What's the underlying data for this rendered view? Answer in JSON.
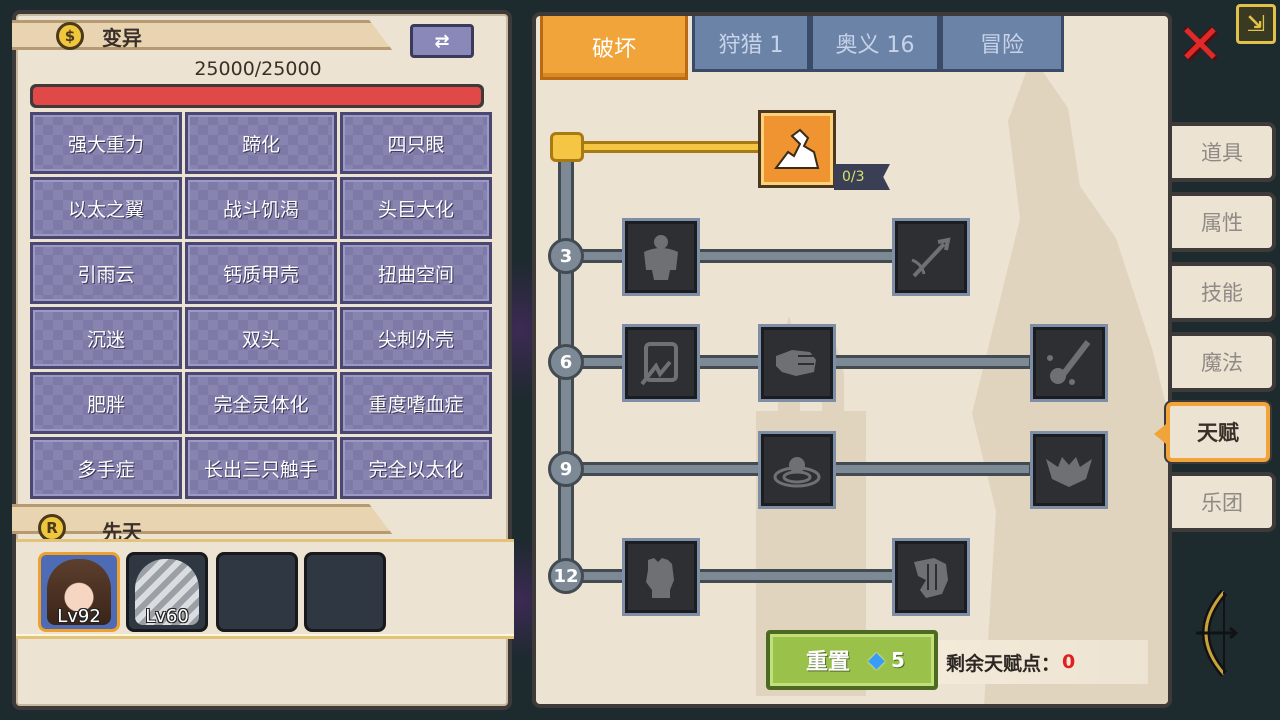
{
  "left_panel": {
    "banner_icon": "$",
    "banner_title": "变异",
    "swap_button_label": "⇄",
    "hp_text": "25000/25000",
    "hp_fraction": 1.0,
    "mutations": [
      "强大重力",
      "蹄化",
      "四只眼",
      "以太之翼",
      "战斗饥渴",
      "头巨大化",
      "引雨云",
      "钙质甲壳",
      "扭曲空间",
      "沉迷",
      "双头",
      "尖刺外壳",
      "肥胖",
      "完全灵体化",
      "重度嗜血症",
      "多手症",
      "长出三只触手",
      "完全以太化"
    ],
    "innate_icon": "R",
    "innate_title": "先天",
    "slots": [
      {
        "label": "Lv92",
        "icon": "princess-portrait-icon"
      },
      {
        "label": "Lv60",
        "icon": "ghost-portrait-icon"
      },
      {
        "label": "",
        "icon": "empty-slot"
      },
      {
        "label": "",
        "icon": "empty-slot"
      }
    ]
  },
  "talent_panel": {
    "tabs": [
      {
        "label": "破坏",
        "active": true
      },
      {
        "label": "狩猎 1",
        "active": false
      },
      {
        "label": "奥义 16",
        "active": false
      },
      {
        "label": "冒险",
        "active": false
      }
    ],
    "root_node": {
      "icon": "arm-wrestle-icon",
      "count": "0/3"
    },
    "levels": [
      "3",
      "6",
      "9",
      "12"
    ],
    "nodes": [
      {
        "tier": "3",
        "icon": "giant-body-icon"
      },
      {
        "tier": "3",
        "icon": "arrow-hit-icon"
      },
      {
        "tier": "6",
        "icon": "shield-break-icon"
      },
      {
        "tier": "6",
        "icon": "punch-icon"
      },
      {
        "tier": "6",
        "icon": "slash-splatter-icon"
      },
      {
        "tier": "9",
        "icon": "shockwave-icon"
      },
      {
        "tier": "9",
        "icon": "demon-bat-icon"
      },
      {
        "tier": "12",
        "icon": "fist-icon"
      },
      {
        "tier": "12",
        "icon": "fist-side-icon"
      }
    ],
    "reset_button": {
      "label": "重置",
      "gem_icon": "diamond-icon",
      "cost": "5"
    },
    "remaining_label": "剩余天赋点：",
    "remaining_value": "0"
  },
  "side_tabs": [
    {
      "label": "道具",
      "active": false
    },
    {
      "label": "属性",
      "active": false
    },
    {
      "label": "技能",
      "active": false
    },
    {
      "label": "魔法",
      "active": false
    },
    {
      "label": "天赋",
      "active": true
    },
    {
      "label": "乐团",
      "active": false
    }
  ],
  "close_label": "✕",
  "expand_label": "⇲",
  "colors": {
    "panel_bg": "#ede3d2",
    "panel_border": "#3e3a39",
    "mutation_cell": "#7d7aa8",
    "active_tab": "#f0a43a",
    "inactive_tab": "#6c83a8",
    "hp_fill": "#e14848",
    "reset_button": "#9ac14a",
    "points_value": "#e02020"
  }
}
